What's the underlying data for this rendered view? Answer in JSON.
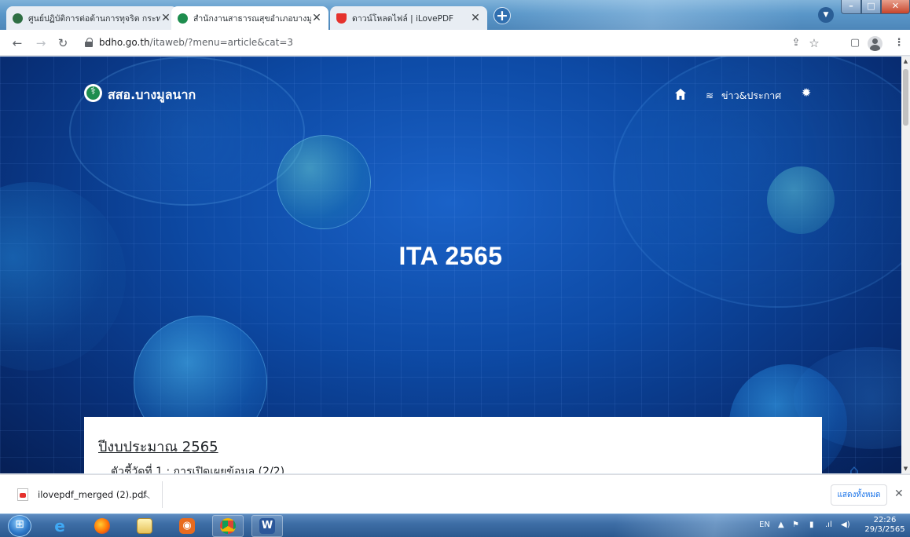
{
  "browser": {
    "tabs": [
      {
        "title": "ศูนย์ปฏิบัติการต่อต้านการทุจริต กระทรว",
        "active": false,
        "favicon_color": "#2e6e43",
        "close_label": "✕"
      },
      {
        "title": "สำนักงานสาธารณสุขอำเภอบางมูลนาก",
        "active": true,
        "favicon_color": "#1e8d4e",
        "close_label": "✕"
      },
      {
        "title": "ดาวน์โหลดไฟล์ | iLovePDF",
        "active": false,
        "favicon_color": "#e5322d",
        "close_label": "✕"
      }
    ],
    "new_tab_label": "+",
    "url_host": "bdho.go.th",
    "url_rest": "/itaweb/?menu=article&cat=3",
    "icons": {
      "back": "back-arrow-icon",
      "forward": "forward-arrow-icon",
      "reload": "reload-icon",
      "share": "share-icon",
      "star": "bookmark-star-icon",
      "sidepanel": "side-panel-icon",
      "profile": "profile-icon",
      "menu": "kebab-menu-icon"
    }
  },
  "site": {
    "brand": "สสอ.บางมูลนาก",
    "nav": {
      "news_label": "ข่าว&ประกาศ"
    },
    "hero_title": "ITA 2565",
    "card": {
      "heading": "ปีงบประมาณ 2565",
      "sub": "ตัวชี้วัดที่ 1 : การเปิดเผยข้อมูล (2/2)"
    }
  },
  "downloads": {
    "file_name": "ilovepdf_merged (2).pdf",
    "show_all_label": "แสดงทั้งหมด",
    "close_label": "✕"
  },
  "taskbar": {
    "lang": "EN",
    "time": "22:26",
    "date": "29/3/2565"
  },
  "colors": {
    "hero_bg": "#0d4aa5",
    "accent": "#1a73e8"
  }
}
